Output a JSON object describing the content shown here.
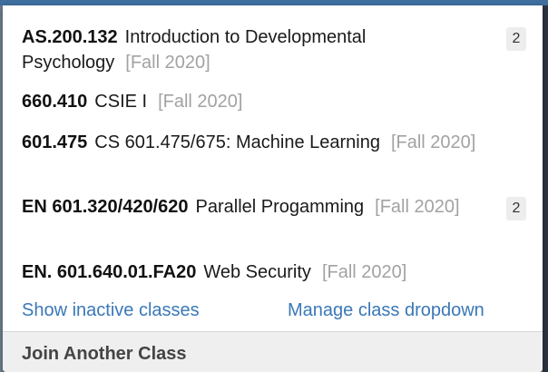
{
  "classes": [
    {
      "number": "AS.200.132",
      "name": "Introduction to Developmental Psychology",
      "term": "[Fall 2020]",
      "badge": "2"
    },
    {
      "number": "660.410",
      "name": "CSIE I",
      "term": "[Fall 2020]",
      "badge": ""
    },
    {
      "number": "601.475",
      "name": "CS 601.475/675: Machine Learning",
      "term": "[Fall 2020]",
      "badge": ""
    },
    {
      "number": "EN 601.320/420/620",
      "name": "Parallel Progamming",
      "term": "[Fall 2020]",
      "badge": "2"
    },
    {
      "number": "EN. 601.640.01.FA20",
      "name": "Web Security",
      "term": "[Fall 2020]",
      "badge": ""
    }
  ],
  "links": {
    "show_inactive": "Show inactive classes",
    "manage_dropdown": "Manage class dropdown"
  },
  "join": {
    "label": "Join Another Class"
  },
  "colors": {
    "link": "#3a78b8",
    "term": "#a2a2a2",
    "top_bar": "#3e6f9f"
  }
}
